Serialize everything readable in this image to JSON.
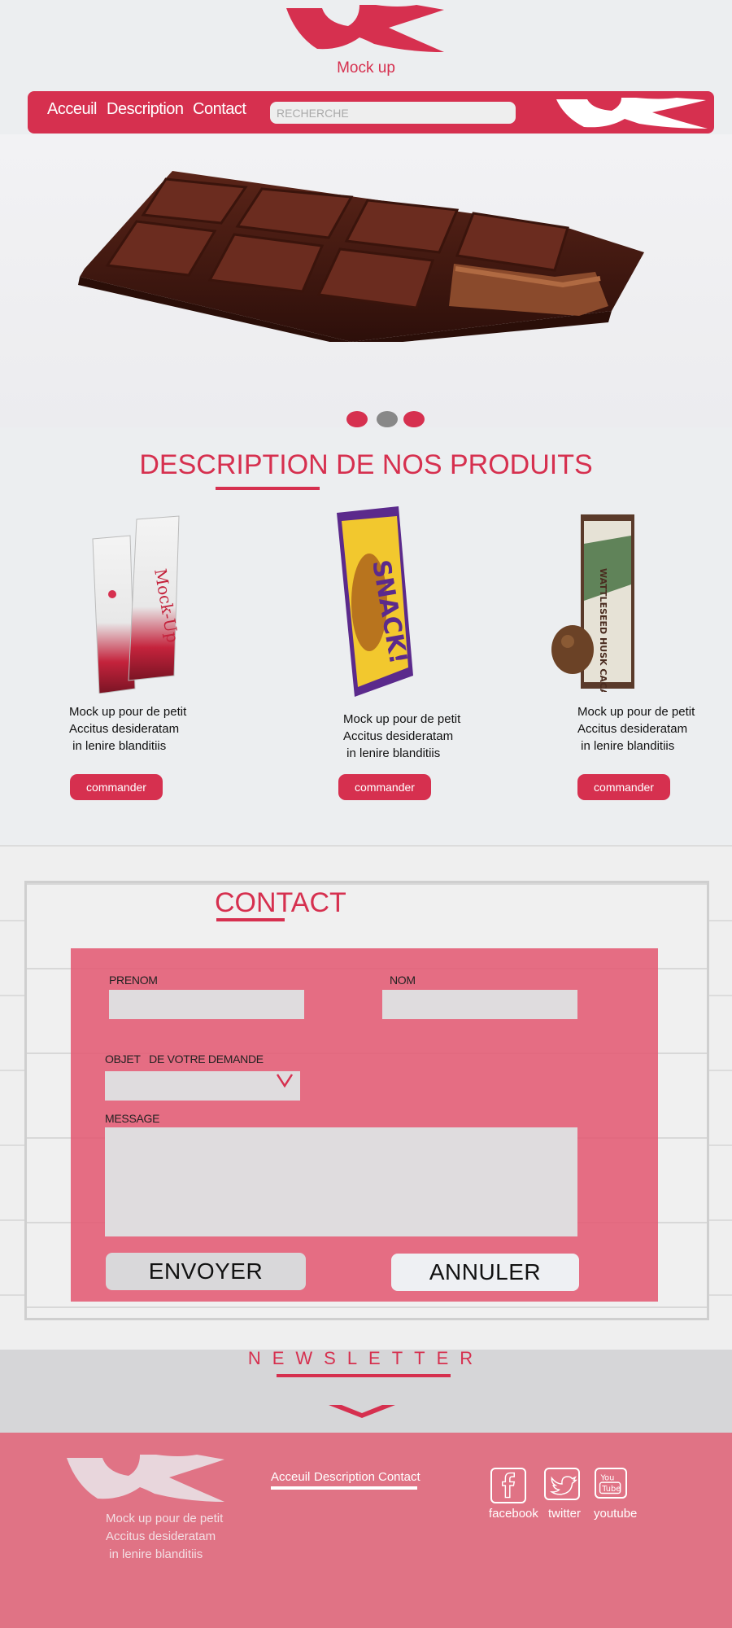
{
  "header": {
    "brand": "Mock up",
    "nav": [
      "Acceuil",
      "Description",
      "Contact"
    ],
    "search_placeholder": "RECHERCHE"
  },
  "colors": {
    "accent": "#d6304f",
    "dot_active": "#888888",
    "footer": "#e07385"
  },
  "hero": {
    "active_slide": 2,
    "slide_count": 3
  },
  "products": {
    "title": "DESCRIPTION DE NOS PRODUITS",
    "items": [
      {
        "text": "Mock up pour de petit\nAccitus desideratam\n in lenire blanditiis",
        "button": "commander",
        "image": "mock-up-sticks"
      },
      {
        "text": "Mock up pour de petit\nAccitus desideratam\n in lenire blanditiis",
        "button": "commander",
        "image": "snack-bar"
      },
      {
        "text": "Mock up pour de petit\nAccitus desideratam\n in lenire blanditiis",
        "button": "commander",
        "image": "wattleseed-bar"
      }
    ]
  },
  "contact": {
    "title": "CONTACT",
    "prenom_label": "PRENOM",
    "nom_label": "NOM",
    "objet_label": "OBJET   DE VOTRE DEMANDE",
    "message_label": "MESSAGE",
    "send_button": "ENVOYER",
    "cancel_button": "ANNULER"
  },
  "newsletter": {
    "title": "NEWSLETTER"
  },
  "footer": {
    "text": "Mock up pour de petit\nAccitus desideratam\n in lenire blanditiis",
    "links": [
      "Acceuil",
      "Description",
      "Contact"
    ],
    "social": [
      {
        "label": "facebook",
        "icon": "facebook-icon"
      },
      {
        "label": "twitter",
        "icon": "twitter-icon"
      },
      {
        "label": "youtube",
        "icon": "youtube-icon"
      }
    ]
  }
}
